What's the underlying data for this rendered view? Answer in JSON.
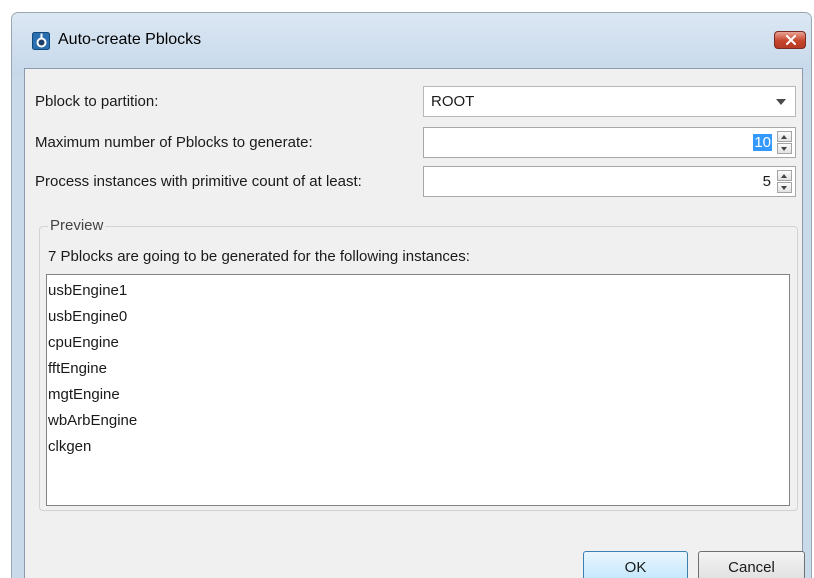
{
  "window": {
    "title": "Auto-create Pblocks"
  },
  "form": {
    "partition_label": "Pblock to partition:",
    "partition_value": "ROOT",
    "max_label": "Maximum number of Pblocks to generate:",
    "max_value": "10",
    "primitive_label": "Process instances with primitive count of at least:",
    "primitive_value": "5"
  },
  "preview": {
    "legend": "Preview",
    "description": "7 Pblocks are going to be generated for the following instances:",
    "instances": [
      "usbEngine1",
      "usbEngine0",
      "cpuEngine",
      "fftEngine",
      "mgtEngine",
      "wbArbEngine",
      "clkgen"
    ]
  },
  "buttons": {
    "ok": "OK",
    "cancel": "Cancel"
  },
  "icons": {
    "app": "vivado-app-icon",
    "close": "close-icon",
    "dropdown": "chevron-down-icon",
    "spin_up": "spin-up-icon",
    "spin_down": "spin-down-icon"
  },
  "colors": {
    "selection": "#3399ff",
    "close_button": "#c8442c",
    "default_button": "#bee6fd"
  }
}
